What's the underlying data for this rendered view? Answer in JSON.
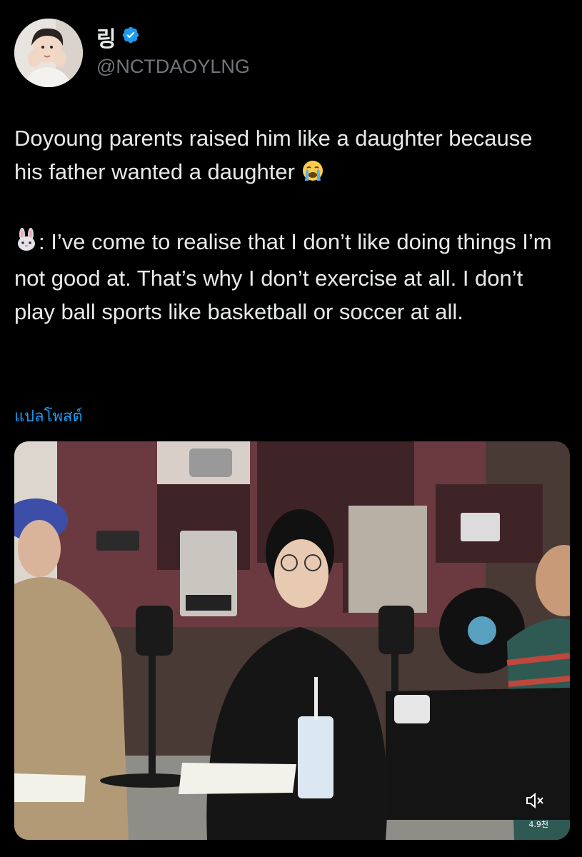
{
  "author": {
    "display_name": "링",
    "handle": "@NCTDAOYLNG",
    "verified": true
  },
  "tweet": {
    "line1": "Doyoung parents raised him like a daughter because his father wanted a daughter",
    "line1_emoji": "loudly-crying-face",
    "quote_emoji": "rabbit-face",
    "quote_text": ": I’ve come to realise that I don’t like doing things I’m not good at. That’s why I don’t exercise at all. I don’t play ball sports like basketball or soccer at all."
  },
  "translate_label": "แปลโพสต์",
  "media": {
    "type": "video",
    "view_count": "4.9천",
    "mute_icon": "speaker-muted-icon"
  },
  "colors": {
    "background": "#000000",
    "text": "#e7e9ea",
    "secondary_text": "#71767b",
    "link": "#1d9bf0",
    "verified": "#1d9bf0"
  }
}
